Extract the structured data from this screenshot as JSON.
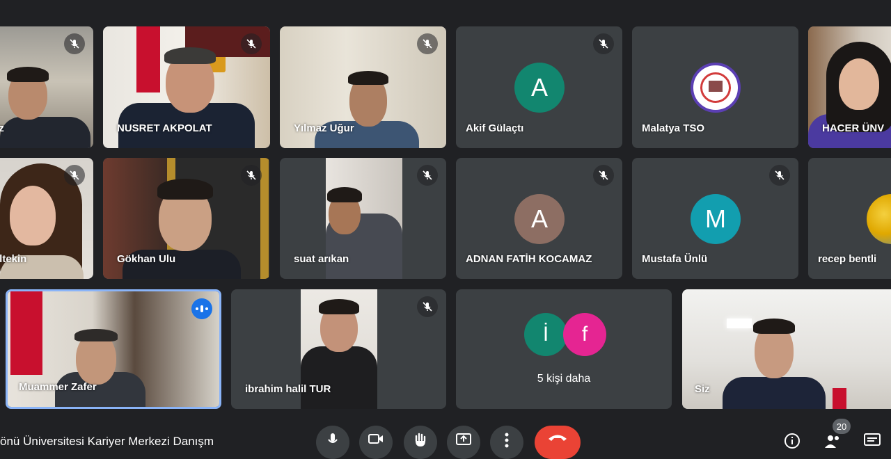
{
  "participants": [
    {
      "name": "az",
      "muted": true
    },
    {
      "name": "NUSRET AKPOLAT",
      "muted": true
    },
    {
      "name": "Yılmaz Uğur",
      "muted": true
    },
    {
      "name": "Akif Gülaçtı",
      "muted": true,
      "initial": "A",
      "color": "#12866f"
    },
    {
      "name": "Malatya TSO",
      "muted": false
    },
    {
      "name": "HACER ÜNV",
      "muted": false
    },
    {
      "name": "ültekin",
      "muted": true
    },
    {
      "name": "Gökhan Ulu",
      "muted": true
    },
    {
      "name": "suat arıkan",
      "muted": true
    },
    {
      "name": "ADNAN FATİH KOCAMAZ",
      "muted": true,
      "initial": "A",
      "color": "#8d6e63"
    },
    {
      "name": "Mustafa Ünlü",
      "muted": true,
      "initial": "M",
      "color": "#129eaf"
    },
    {
      "name": "recep bentli",
      "muted": false
    },
    {
      "name": "Muammer Zafer",
      "muted": false,
      "speaking": true
    },
    {
      "name": "ibrahim halil TUR",
      "muted": true
    },
    {
      "name": "Siz",
      "muted": false
    }
  ],
  "more": {
    "label": "5 kişi daha",
    "initials": [
      "İ",
      "f"
    ],
    "colors": [
      "#12866f",
      "#e52592"
    ]
  },
  "bottom_bar": {
    "meeting_title": "önü Üniversitesi Kariyer Merkezi Danışm",
    "participant_count": "20",
    "end_call_color": "#ea4335"
  }
}
